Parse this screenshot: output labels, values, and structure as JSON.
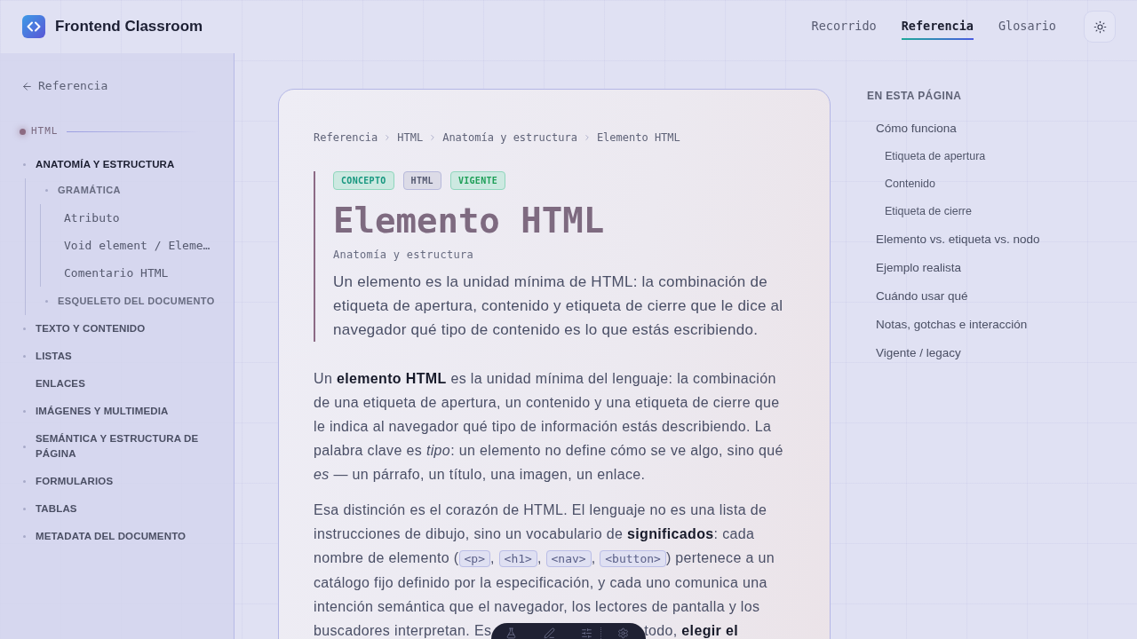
{
  "header": {
    "brand": "Frontend Classroom",
    "nav": [
      {
        "label": "Recorrido",
        "selected": false
      },
      {
        "label": "Referencia",
        "selected": true
      },
      {
        "label": "Glosario",
        "selected": false
      }
    ]
  },
  "sidebar": {
    "back_link": "Referencia",
    "section": "HTML",
    "items": [
      {
        "label": "ANATOMÍA Y ESTRUCTURA",
        "selected": true,
        "bullet": true,
        "children": [
          {
            "label": "GRAMÁTICA",
            "selected": false,
            "bullet": true,
            "children": [
              {
                "label": "Atributo",
                "selected": false,
                "bullet": false
              },
              {
                "label": "Void element / Eleme…",
                "selected": false,
                "bullet": false
              },
              {
                "label": "Comentario HTML",
                "selected": false,
                "bullet": false
              }
            ]
          },
          {
            "label": "ESQUELETO DEL DOCUMENTO",
            "selected": false,
            "bullet": true
          }
        ]
      },
      {
        "label": "TEXTO Y CONTENIDO",
        "selected": false,
        "bullet": true
      },
      {
        "label": "LISTAS",
        "selected": false,
        "bullet": true
      },
      {
        "label": "ENLACES",
        "selected": false,
        "bullet": false
      },
      {
        "label": "IMÁGENES Y MULTIMEDIA",
        "selected": false,
        "bullet": true
      },
      {
        "label": "SEMÁNTICA Y ESTRUCTURA DE PÁGINA",
        "selected": false,
        "bullet": true
      },
      {
        "label": "FORMULARIOS",
        "selected": false,
        "bullet": true
      },
      {
        "label": "TABLAS",
        "selected": false,
        "bullet": true
      },
      {
        "label": "METADATA DEL DOCUMENTO",
        "selected": false,
        "bullet": true
      }
    ]
  },
  "article": {
    "breadcrumb": [
      "Referencia",
      "HTML",
      "Anatomía y estructura",
      "Elemento HTML"
    ],
    "tags": [
      {
        "label": "CONCEPTO",
        "kind": "type"
      },
      {
        "label": "HTML",
        "kind": "language"
      },
      {
        "label": "VIGENTE",
        "kind": "status"
      }
    ],
    "title": "Elemento HTML",
    "subtitle": "Anatomía y estructura",
    "lead": "Un elemento es la unidad mínima de HTML: la combinación de etiqueta de apertura, contenido y etiqueta de cierre que le dice al navegador qué tipo de contenido es lo que estás escribiendo.",
    "paragraphs": [
      {
        "segments": [
          {
            "kind": "text",
            "text": "Un **elemento HTML** es la unidad mínima del lenguaje: la combinación de una etiqueta de apertura, un contenido y una etiqueta de cierre que le indica al navegador qué tipo de información estás describiendo. La palabra clave es *tipo*: un elemento no define cómo se ve algo, sino qué *es* — un párrafo, un título, una imagen, un enlace."
          }
        ]
      },
      {
        "segments": [
          {
            "kind": "text",
            "text": "Esa distinción es el corazón de HTML. El lenguaje no es una lista de instrucciones de dibujo, sino un vocabulario de **significados**: cada nombre de elemento ("
          },
          {
            "kind": "code",
            "text": "<p>"
          },
          {
            "kind": "text",
            "text": ", "
          },
          {
            "kind": "code",
            "text": "<h1>"
          },
          {
            "kind": "text",
            "text": ", "
          },
          {
            "kind": "code",
            "text": "<nav>"
          },
          {
            "kind": "text",
            "text": ", "
          },
          {
            "kind": "code",
            "text": "<button>"
          },
          {
            "kind": "text",
            "text": ") pertenece a un catálogo fijo definido por la especificación, y cada uno comunica una intención semántica que el navegador, los lectores de pantalla y los"
          }
        ],
        "cut_line": {
          "before": "buscadores interpretan. Es",
          "after": "todo, **elegir el**"
        }
      }
    ]
  },
  "toc": {
    "title": "EN ESTA PÁGINA",
    "items": [
      {
        "label": "Cómo funciona",
        "children": [
          {
            "label": "Etiqueta de apertura"
          },
          {
            "label": "Contenido"
          },
          {
            "label": "Etiqueta de cierre"
          }
        ]
      },
      {
        "label": "Elemento vs. etiqueta vs. nodo"
      },
      {
        "label": "Ejemplo realista"
      },
      {
        "label": "Cuándo usar qué"
      },
      {
        "label": "Notas, gotchas e interacción"
      },
      {
        "label": "Vigente / legacy"
      }
    ]
  }
}
